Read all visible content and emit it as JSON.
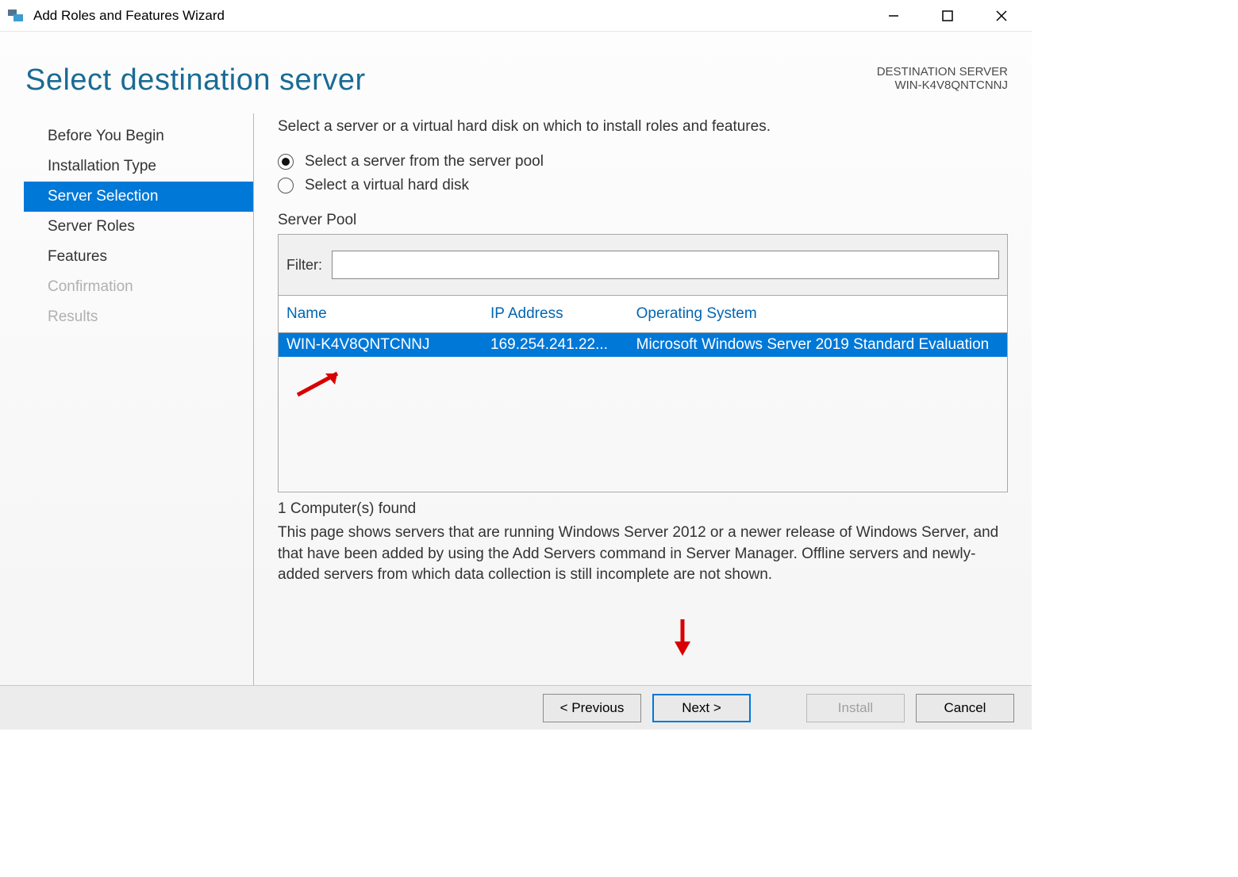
{
  "titlebar": {
    "title": "Add Roles and Features Wizard"
  },
  "header": {
    "title": "Select destination server",
    "destLabel": "DESTINATION SERVER",
    "destValue": "WIN-K4V8QNTCNNJ"
  },
  "sidebar": {
    "items": [
      {
        "label": "Before You Begin",
        "state": "normal"
      },
      {
        "label": "Installation Type",
        "state": "normal"
      },
      {
        "label": "Server Selection",
        "state": "selected"
      },
      {
        "label": "Server Roles",
        "state": "normal"
      },
      {
        "label": "Features",
        "state": "normal"
      },
      {
        "label": "Confirmation",
        "state": "disabled"
      },
      {
        "label": "Results",
        "state": "disabled"
      }
    ]
  },
  "panel": {
    "intro": "Select a server or a virtual hard disk on which to install roles and features.",
    "radios": {
      "pool": "Select a server from the server pool",
      "vhd": "Select a virtual hard disk"
    },
    "sectionTitle": "Server Pool",
    "filterLabel": "Filter:",
    "filterValue": "",
    "columns": {
      "name": "Name",
      "ip": "IP Address",
      "os": "Operating System"
    },
    "rows": [
      {
        "name": "WIN-K4V8QNTCNNJ",
        "ip": "169.254.241.22...",
        "os": "Microsoft Windows Server 2019 Standard Evaluation"
      }
    ],
    "found": "1 Computer(s) found",
    "explain": "This page shows servers that are running Windows Server 2012 or a newer release of Windows Server, and that have been added by using the Add Servers command in Server Manager. Offline servers and newly-added servers from which data collection is still incomplete are not shown."
  },
  "footer": {
    "previous": "< Previous",
    "next": "Next >",
    "install": "Install",
    "cancel": "Cancel"
  }
}
